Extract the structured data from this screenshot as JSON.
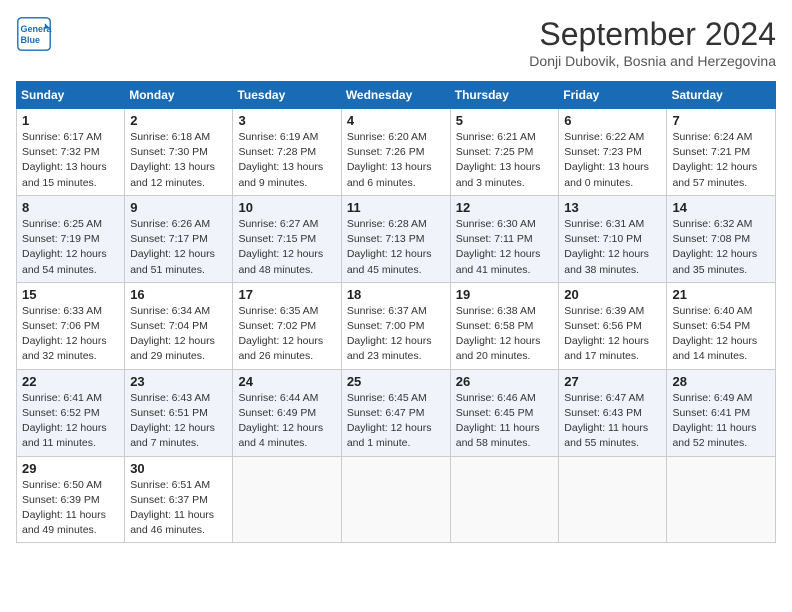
{
  "header": {
    "logo_line1": "General",
    "logo_line2": "Blue",
    "month": "September 2024",
    "location": "Donji Dubovik, Bosnia and Herzegovina"
  },
  "weekdays": [
    "Sunday",
    "Monday",
    "Tuesday",
    "Wednesday",
    "Thursday",
    "Friday",
    "Saturday"
  ],
  "weeks": [
    [
      {
        "day": "1",
        "info": "Sunrise: 6:17 AM\nSunset: 7:32 PM\nDaylight: 13 hours\nand 15 minutes."
      },
      {
        "day": "2",
        "info": "Sunrise: 6:18 AM\nSunset: 7:30 PM\nDaylight: 13 hours\nand 12 minutes."
      },
      {
        "day": "3",
        "info": "Sunrise: 6:19 AM\nSunset: 7:28 PM\nDaylight: 13 hours\nand 9 minutes."
      },
      {
        "day": "4",
        "info": "Sunrise: 6:20 AM\nSunset: 7:26 PM\nDaylight: 13 hours\nand 6 minutes."
      },
      {
        "day": "5",
        "info": "Sunrise: 6:21 AM\nSunset: 7:25 PM\nDaylight: 13 hours\nand 3 minutes."
      },
      {
        "day": "6",
        "info": "Sunrise: 6:22 AM\nSunset: 7:23 PM\nDaylight: 13 hours\nand 0 minutes."
      },
      {
        "day": "7",
        "info": "Sunrise: 6:24 AM\nSunset: 7:21 PM\nDaylight: 12 hours\nand 57 minutes."
      }
    ],
    [
      {
        "day": "8",
        "info": "Sunrise: 6:25 AM\nSunset: 7:19 PM\nDaylight: 12 hours\nand 54 minutes."
      },
      {
        "day": "9",
        "info": "Sunrise: 6:26 AM\nSunset: 7:17 PM\nDaylight: 12 hours\nand 51 minutes."
      },
      {
        "day": "10",
        "info": "Sunrise: 6:27 AM\nSunset: 7:15 PM\nDaylight: 12 hours\nand 48 minutes."
      },
      {
        "day": "11",
        "info": "Sunrise: 6:28 AM\nSunset: 7:13 PM\nDaylight: 12 hours\nand 45 minutes."
      },
      {
        "day": "12",
        "info": "Sunrise: 6:30 AM\nSunset: 7:11 PM\nDaylight: 12 hours\nand 41 minutes."
      },
      {
        "day": "13",
        "info": "Sunrise: 6:31 AM\nSunset: 7:10 PM\nDaylight: 12 hours\nand 38 minutes."
      },
      {
        "day": "14",
        "info": "Sunrise: 6:32 AM\nSunset: 7:08 PM\nDaylight: 12 hours\nand 35 minutes."
      }
    ],
    [
      {
        "day": "15",
        "info": "Sunrise: 6:33 AM\nSunset: 7:06 PM\nDaylight: 12 hours\nand 32 minutes."
      },
      {
        "day": "16",
        "info": "Sunrise: 6:34 AM\nSunset: 7:04 PM\nDaylight: 12 hours\nand 29 minutes."
      },
      {
        "day": "17",
        "info": "Sunrise: 6:35 AM\nSunset: 7:02 PM\nDaylight: 12 hours\nand 26 minutes."
      },
      {
        "day": "18",
        "info": "Sunrise: 6:37 AM\nSunset: 7:00 PM\nDaylight: 12 hours\nand 23 minutes."
      },
      {
        "day": "19",
        "info": "Sunrise: 6:38 AM\nSunset: 6:58 PM\nDaylight: 12 hours\nand 20 minutes."
      },
      {
        "day": "20",
        "info": "Sunrise: 6:39 AM\nSunset: 6:56 PM\nDaylight: 12 hours\nand 17 minutes."
      },
      {
        "day": "21",
        "info": "Sunrise: 6:40 AM\nSunset: 6:54 PM\nDaylight: 12 hours\nand 14 minutes."
      }
    ],
    [
      {
        "day": "22",
        "info": "Sunrise: 6:41 AM\nSunset: 6:52 PM\nDaylight: 12 hours\nand 11 minutes."
      },
      {
        "day": "23",
        "info": "Sunrise: 6:43 AM\nSunset: 6:51 PM\nDaylight: 12 hours\nand 7 minutes."
      },
      {
        "day": "24",
        "info": "Sunrise: 6:44 AM\nSunset: 6:49 PM\nDaylight: 12 hours\nand 4 minutes."
      },
      {
        "day": "25",
        "info": "Sunrise: 6:45 AM\nSunset: 6:47 PM\nDaylight: 12 hours\nand 1 minute."
      },
      {
        "day": "26",
        "info": "Sunrise: 6:46 AM\nSunset: 6:45 PM\nDaylight: 11 hours\nand 58 minutes."
      },
      {
        "day": "27",
        "info": "Sunrise: 6:47 AM\nSunset: 6:43 PM\nDaylight: 11 hours\nand 55 minutes."
      },
      {
        "day": "28",
        "info": "Sunrise: 6:49 AM\nSunset: 6:41 PM\nDaylight: 11 hours\nand 52 minutes."
      }
    ],
    [
      {
        "day": "29",
        "info": "Sunrise: 6:50 AM\nSunset: 6:39 PM\nDaylight: 11 hours\nand 49 minutes."
      },
      {
        "day": "30",
        "info": "Sunrise: 6:51 AM\nSunset: 6:37 PM\nDaylight: 11 hours\nand 46 minutes."
      },
      {
        "day": "",
        "info": ""
      },
      {
        "day": "",
        "info": ""
      },
      {
        "day": "",
        "info": ""
      },
      {
        "day": "",
        "info": ""
      },
      {
        "day": "",
        "info": ""
      }
    ]
  ]
}
